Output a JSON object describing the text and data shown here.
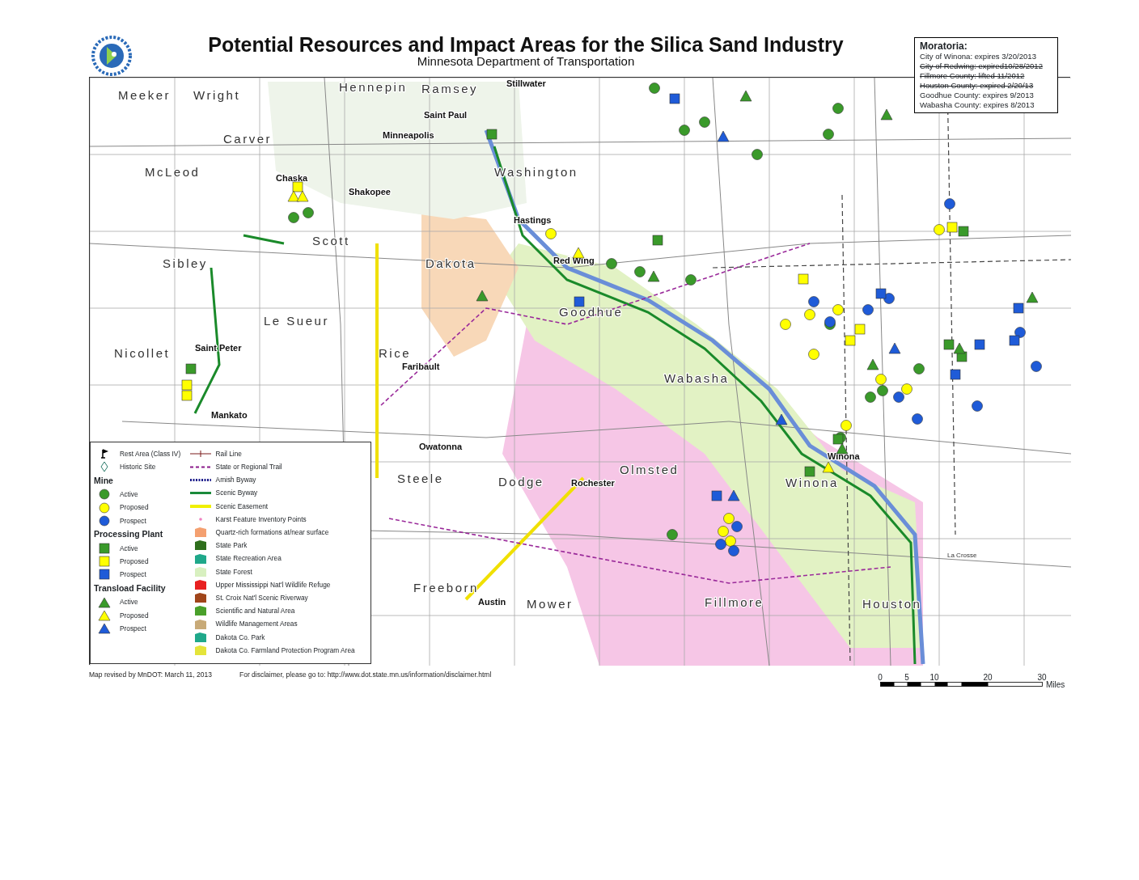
{
  "header": {
    "title": "Potential Resources and Impact Areas for the Silica Sand Industry",
    "subtitle": "Minnesota Department of Transportation"
  },
  "moratoria": {
    "title": "Moratoria:",
    "items": [
      {
        "text": "City of Winona: expires 3/20/2013",
        "struck": false
      },
      {
        "text": "City of Redwing: expired10/28/2012",
        "struck": true
      },
      {
        "text": "Fillmore County: lifted 11/2012",
        "struck": true
      },
      {
        "text": "Houston County: expired 2/20/13",
        "struck": true
      },
      {
        "text": "Goodhue County: expires 9/2013",
        "struck": false
      },
      {
        "text": "Wabasha County: expires 8/2013",
        "struck": false
      }
    ]
  },
  "map": {
    "labels": [
      {
        "text": "Meeker",
        "kind": "county"
      },
      {
        "text": "Wright",
        "kind": "county"
      },
      {
        "text": "Hennepin",
        "kind": "county"
      },
      {
        "text": "Ramsey",
        "kind": "county"
      },
      {
        "text": "Stillwater",
        "kind": "city"
      },
      {
        "text": "Saint Paul",
        "kind": "city"
      },
      {
        "text": "Minneapolis",
        "kind": "city"
      },
      {
        "text": "Carver",
        "kind": "county"
      },
      {
        "text": "McLeod",
        "kind": "county"
      },
      {
        "text": "Chaska",
        "kind": "city"
      },
      {
        "text": "Shakopee",
        "kind": "city"
      },
      {
        "text": "Washington",
        "kind": "county"
      },
      {
        "text": "Hastings",
        "kind": "city"
      },
      {
        "text": "Scott",
        "kind": "county"
      },
      {
        "text": "Sibley",
        "kind": "county"
      },
      {
        "text": "Dakota",
        "kind": "county"
      },
      {
        "text": "Red Wing",
        "kind": "city"
      },
      {
        "text": "Goodhue",
        "kind": "county"
      },
      {
        "text": "Le Sueur",
        "kind": "county"
      },
      {
        "text": "Nicollet",
        "kind": "county"
      },
      {
        "text": "Saint Peter",
        "kind": "city"
      },
      {
        "text": "Rice",
        "kind": "county"
      },
      {
        "text": "Faribault",
        "kind": "city"
      },
      {
        "text": "Wabasha",
        "kind": "county"
      },
      {
        "text": "Mankato",
        "kind": "city"
      },
      {
        "text": "Owatonna",
        "kind": "city"
      },
      {
        "text": "Steele",
        "kind": "county"
      },
      {
        "text": "Olmsted",
        "kind": "county"
      },
      {
        "text": "Dodge",
        "kind": "county"
      },
      {
        "text": "Rochester",
        "kind": "city"
      },
      {
        "text": "Winona",
        "kind": "city"
      },
      {
        "text": "Winona",
        "kind": "county"
      },
      {
        "text": "Freeborn",
        "kind": "county"
      },
      {
        "text": "Austin",
        "kind": "city"
      },
      {
        "text": "Mower",
        "kind": "county"
      },
      {
        "text": "Fillmore",
        "kind": "county"
      },
      {
        "text": "Houston",
        "kind": "county"
      },
      {
        "text": "La Crosse",
        "kind": "town"
      }
    ]
  },
  "legend": {
    "left": [
      {
        "kind": "rest-area",
        "label": "Rest Area (Class IV)"
      },
      {
        "kind": "historic-site",
        "label": "Historic Site"
      },
      {
        "kind": "heading",
        "label": "Mine"
      },
      {
        "kind": "circle-active",
        "label": "Active"
      },
      {
        "kind": "circle-proposed",
        "label": "Proposed"
      },
      {
        "kind": "circle-prospect",
        "label": "Prospect"
      },
      {
        "kind": "heading",
        "label": "Processing Plant"
      },
      {
        "kind": "square-active",
        "label": "Active"
      },
      {
        "kind": "square-proposed",
        "label": "Proposed"
      },
      {
        "kind": "square-prospect",
        "label": "Prospect"
      },
      {
        "kind": "heading",
        "label": "Transload Facility"
      },
      {
        "kind": "triangle-active",
        "label": "Active"
      },
      {
        "kind": "triangle-proposed",
        "label": "Proposed"
      },
      {
        "kind": "triangle-prospect",
        "label": "Prospect"
      }
    ],
    "right": [
      {
        "kind": "rail-line",
        "label": "Rail Line"
      },
      {
        "kind": "trail",
        "label": "State or Regional Trail"
      },
      {
        "kind": "amish-byway",
        "label": "Amish Byway"
      },
      {
        "kind": "scenic-byway",
        "label": "Scenic Byway"
      },
      {
        "kind": "scenic-easement",
        "label": "Scenic Easement"
      },
      {
        "kind": "karst",
        "label": "Karst Feature Inventory Points"
      },
      {
        "kind": "area",
        "color": "#f4a070",
        "label": "Quartz-rich formations at/near surface"
      },
      {
        "kind": "area",
        "color": "#2e6e1c",
        "label": "State Park"
      },
      {
        "kind": "area",
        "color": "#1fa88a",
        "label": "State Recreation Area"
      },
      {
        "kind": "area",
        "color": "#d8f0c0",
        "label": "State Forest"
      },
      {
        "kind": "area",
        "color": "#e82020",
        "label": "Upper Mississippi Nat'l Wildlife Refuge"
      },
      {
        "kind": "area",
        "color": "#a0451a",
        "label": "St. Croix Nat'l Scenic Riverway"
      },
      {
        "kind": "area",
        "color": "#4aa02a",
        "label": "Scientific and Natural Area"
      },
      {
        "kind": "area",
        "color": "#c8aa78",
        "label": "Wildlife Management Areas"
      },
      {
        "kind": "area",
        "color": "#1fa88a",
        "label": "Dakota Co. Park"
      },
      {
        "kind": "area",
        "color": "#e4e43a",
        "label": "Dakota Co. Farmland Protection Program Area"
      }
    ]
  },
  "footer": {
    "revised": "Map revised by MnDOT: March 11, 2013",
    "disclaimer": "For disclaimer, please go to: http://www.dot.state.mn.us/information/disclaimer.html"
  },
  "scale": {
    "ticks": [
      "0",
      "5",
      "10",
      "20",
      "30"
    ],
    "unit": "Miles"
  }
}
